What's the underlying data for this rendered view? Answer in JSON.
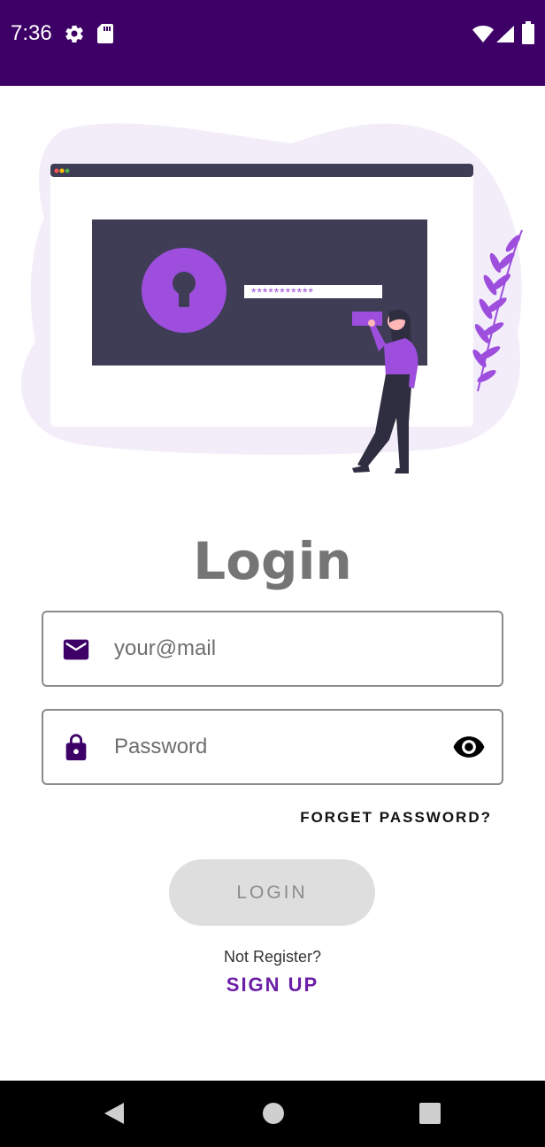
{
  "status_bar": {
    "time": "7:36",
    "left_icons": [
      "gear-icon",
      "sd-card-icon"
    ],
    "right_icons": [
      "wifi-icon",
      "signal-icon",
      "battery-icon"
    ],
    "color": "#3d0066"
  },
  "illustration": {
    "password_mask": "***********",
    "accent_color": "#9d4edd"
  },
  "login": {
    "title": "Login",
    "email": {
      "placeholder": "your@mail",
      "icon": "mail-icon"
    },
    "password": {
      "placeholder": "Password",
      "icon": "lock-icon",
      "toggle_icon": "eye-icon"
    },
    "forget_label": "FORGET PASSWORD?",
    "button_label": "LOGIN",
    "not_register": "Not Register?",
    "signup_label": "SIGN UP",
    "accent_color": "#6b1fa6"
  },
  "nav_bar": {
    "buttons": [
      "back-icon",
      "home-icon",
      "recents-icon"
    ]
  }
}
